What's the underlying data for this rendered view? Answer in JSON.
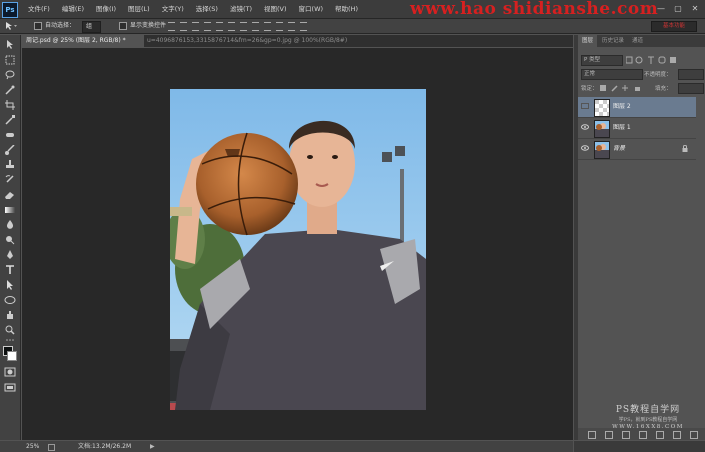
{
  "app": {
    "logo_text": "Ps"
  },
  "menu": [
    "文件(F)",
    "编辑(E)",
    "图像(I)",
    "图层(L)",
    "文字(Y)",
    "选择(S)",
    "滤镜(T)",
    "视图(V)",
    "窗口(W)",
    "帮助(H)"
  ],
  "watermark_top": "www.hao shidianshe.com",
  "window_controls": [
    "—",
    "▢",
    "✕"
  ],
  "options": {
    "auto_select_label": "自动选择：",
    "auto_select_value": "组",
    "show_transform_label": "显示变换控件",
    "workspace": "基本功能"
  },
  "tabs": [
    {
      "label": "周记.psd @ 25% (图层 2, RGB/8) *",
      "active": true
    },
    {
      "label": "u=4096876153,3315876714&fm=26&gp=0.jpg @ 100%(RGB/8#)",
      "active": false
    }
  ],
  "layers_panel": {
    "tabs": [
      "图层",
      "历史记录",
      "通道"
    ],
    "kind_filter": "P 类型",
    "blend_mode": "正常",
    "opacity_label": "不透明度：",
    "lock_label": "锁定：",
    "fill_label": "填充：",
    "layers": [
      {
        "name": "图层 2",
        "selected": true,
        "visible": false,
        "locked": false
      },
      {
        "name": "图层 1",
        "selected": false,
        "visible": true,
        "locked": false
      },
      {
        "name": "背景",
        "selected": false,
        "visible": true,
        "locked": true
      }
    ]
  },
  "watermark_bottom": {
    "line1": "PS教程自学网",
    "line2": "学PS，就到PS教程自学网",
    "line3": "WWW.16XX8.COM"
  },
  "status": {
    "zoom": "25%",
    "doc": "文档:13.2M/26.2M"
  },
  "colors": {
    "menubar": "#3c3c3c",
    "panel": "#535353",
    "canvas": "#282828",
    "selected_layer": "#6a7b90",
    "watermark_red": "#d62020"
  }
}
